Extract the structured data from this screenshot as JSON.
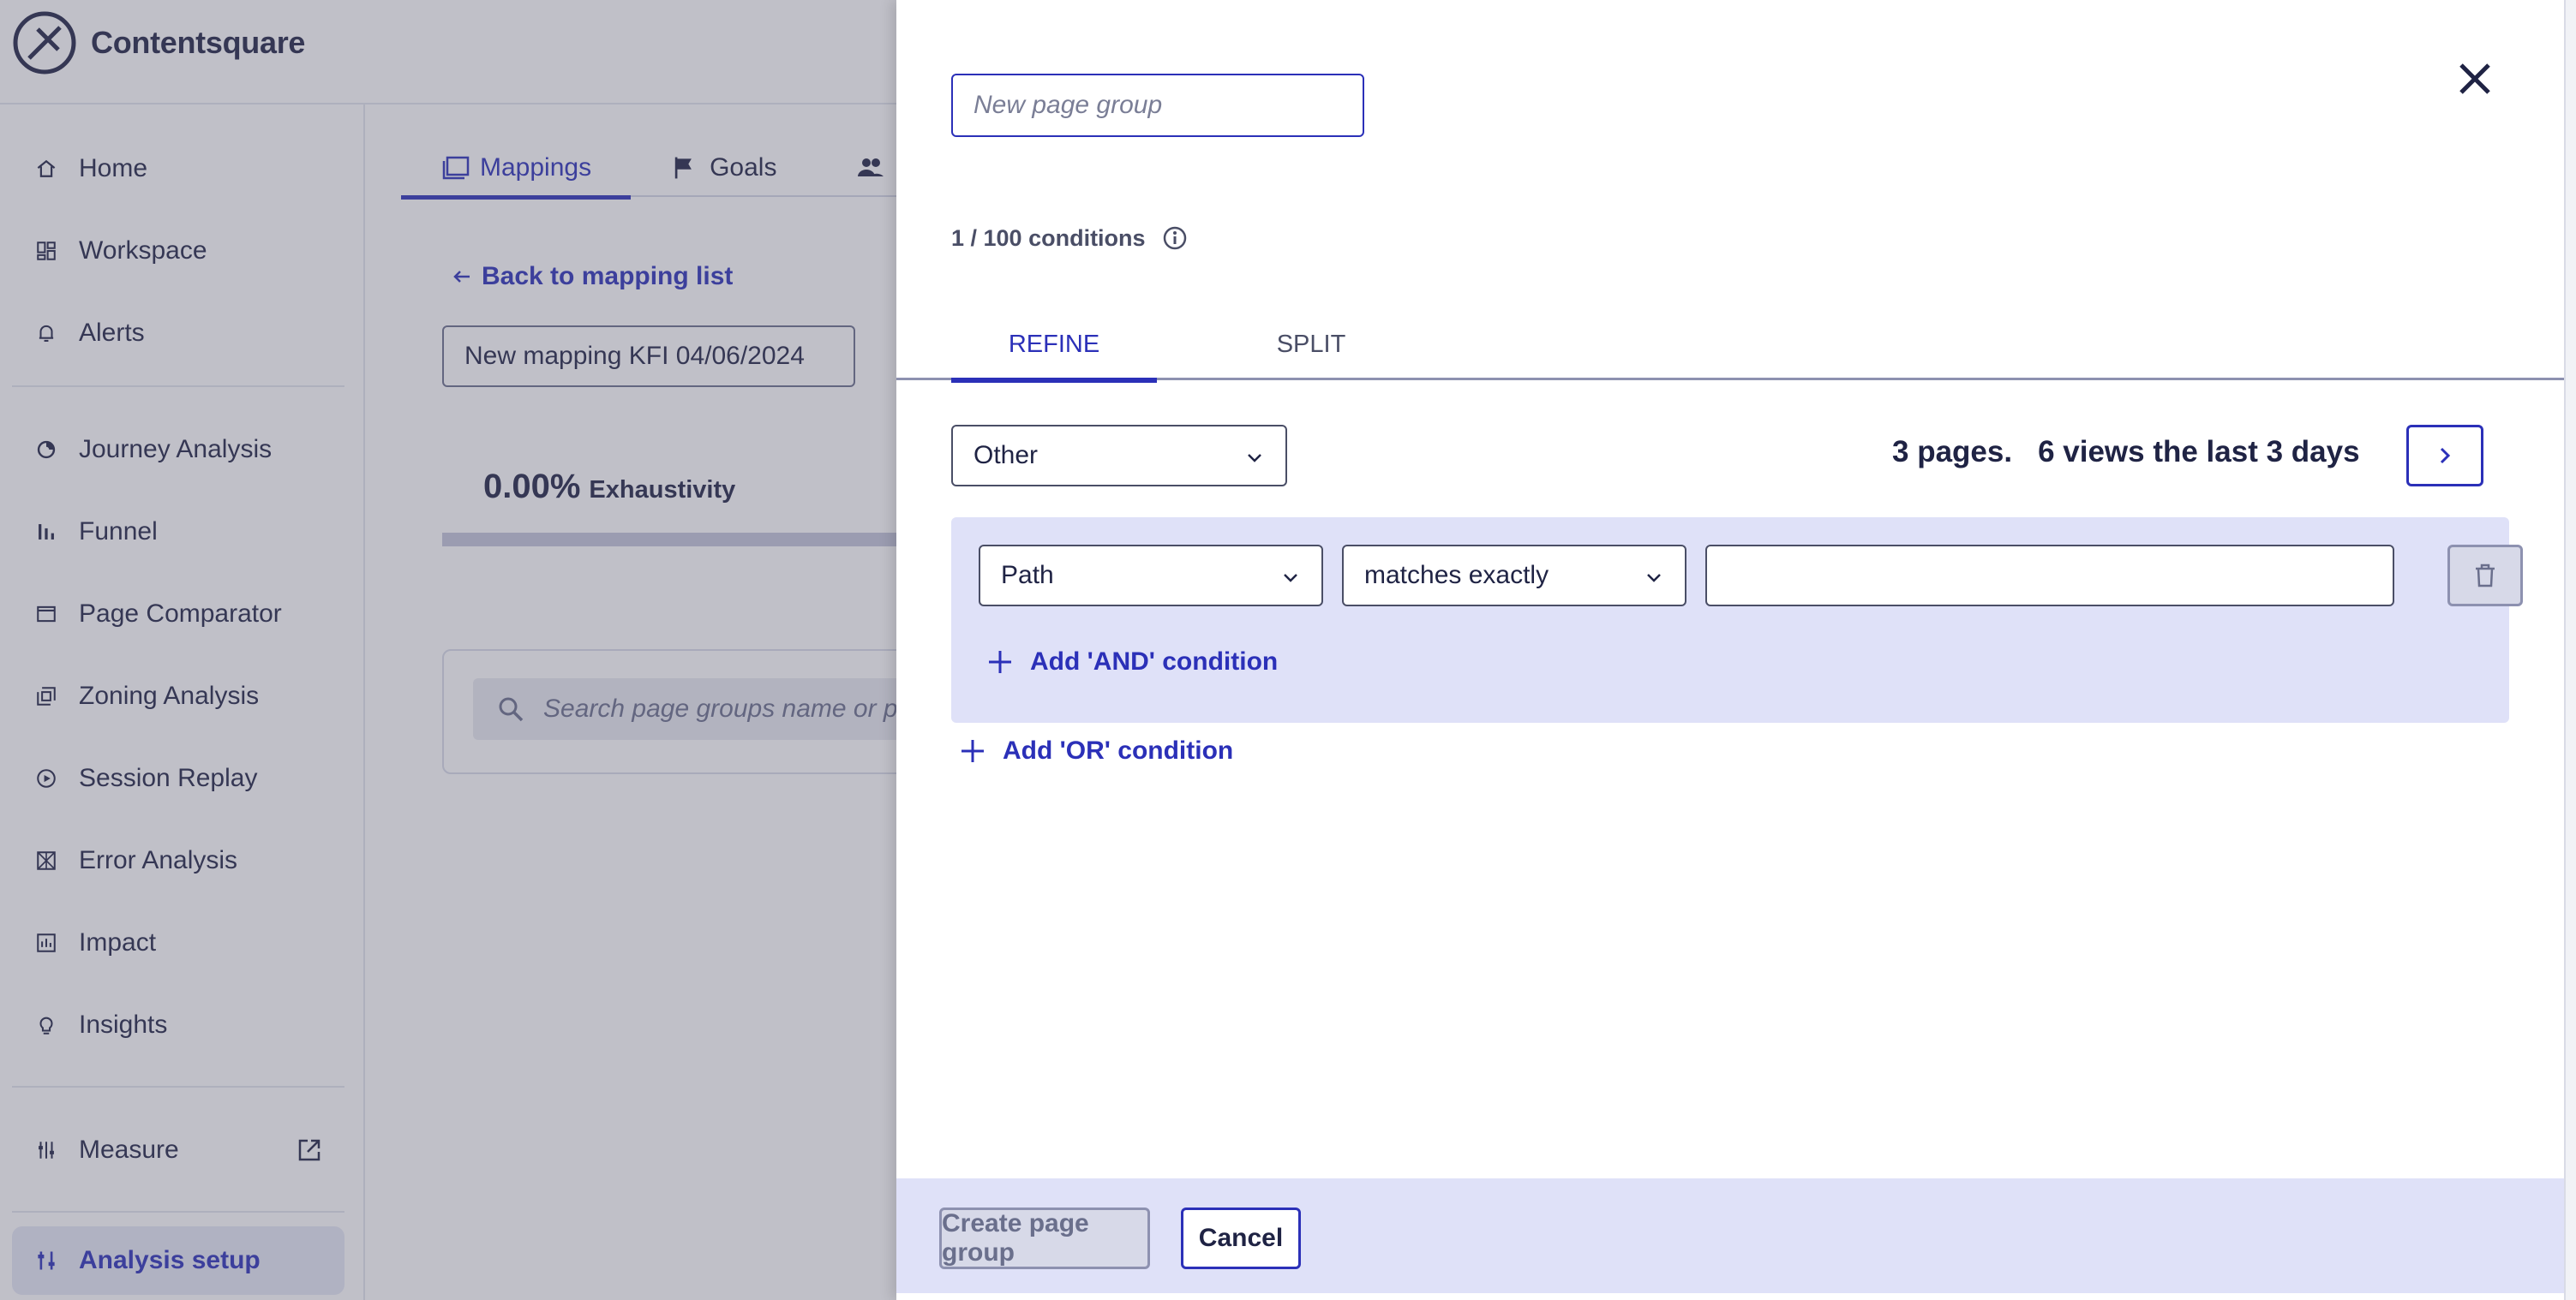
{
  "app": {
    "name": "Contentsquare",
    "logo_icon": "contentsquare-logo-icon"
  },
  "sidebar": {
    "items": [
      {
        "label": "Home",
        "icon": "home-icon"
      },
      {
        "label": "Workspace",
        "icon": "workspace-icon"
      },
      {
        "label": "Alerts",
        "icon": "bell-icon"
      },
      {
        "label": "Journey Analysis",
        "icon": "journey-icon"
      },
      {
        "label": "Funnel",
        "icon": "funnel-icon"
      },
      {
        "label": "Page Comparator",
        "icon": "page-comparator-icon"
      },
      {
        "label": "Zoning Analysis",
        "icon": "zoning-icon"
      },
      {
        "label": "Session Replay",
        "icon": "play-icon"
      },
      {
        "label": "Error Analysis",
        "icon": "error-icon"
      },
      {
        "label": "Impact",
        "icon": "impact-icon"
      },
      {
        "label": "Insights",
        "icon": "lightbulb-icon"
      },
      {
        "label": "Measure",
        "icon": "measure-icon",
        "external_icon": "external-link-icon"
      },
      {
        "label": "Analysis setup",
        "icon": "settings-sliders-icon",
        "active": true
      }
    ]
  },
  "main": {
    "tabs": [
      {
        "label": "Mappings",
        "icon": "mappings-icon",
        "active": true
      },
      {
        "label": "Goals",
        "icon": "flag-icon"
      },
      {
        "label": "",
        "icon": "users-icon"
      }
    ],
    "back_link": "Back to mapping list",
    "mapping_name": "New mapping KFI 04/06/2024",
    "exhaustivity": {
      "value": "0.00%",
      "label": "Exhaustivity"
    },
    "search_placeholder": "Search page groups name or pa"
  },
  "drawer": {
    "group_name_placeholder": "New page group",
    "conditions_count": "1 / 100 conditions",
    "tabs": [
      {
        "label": "REFINE",
        "active": true
      },
      {
        "label": "SPLIT",
        "active": false
      }
    ],
    "source_select": "Other",
    "stats": {
      "pages": "3 pages.",
      "views": "6 views the last 3 days"
    },
    "condition": {
      "field": "Path",
      "operator": "matches exactly",
      "value": ""
    },
    "add_and_label": "Add 'AND' condition",
    "add_or_label": "Add 'OR' condition",
    "create_button": "Create page group",
    "cancel_button": "Cancel"
  },
  "colors": {
    "accent": "#2b30b8",
    "text": "#1f2344",
    "condition_bg": "#dfe1f8",
    "overlay": "rgba(90,90,110,0.38)"
  }
}
